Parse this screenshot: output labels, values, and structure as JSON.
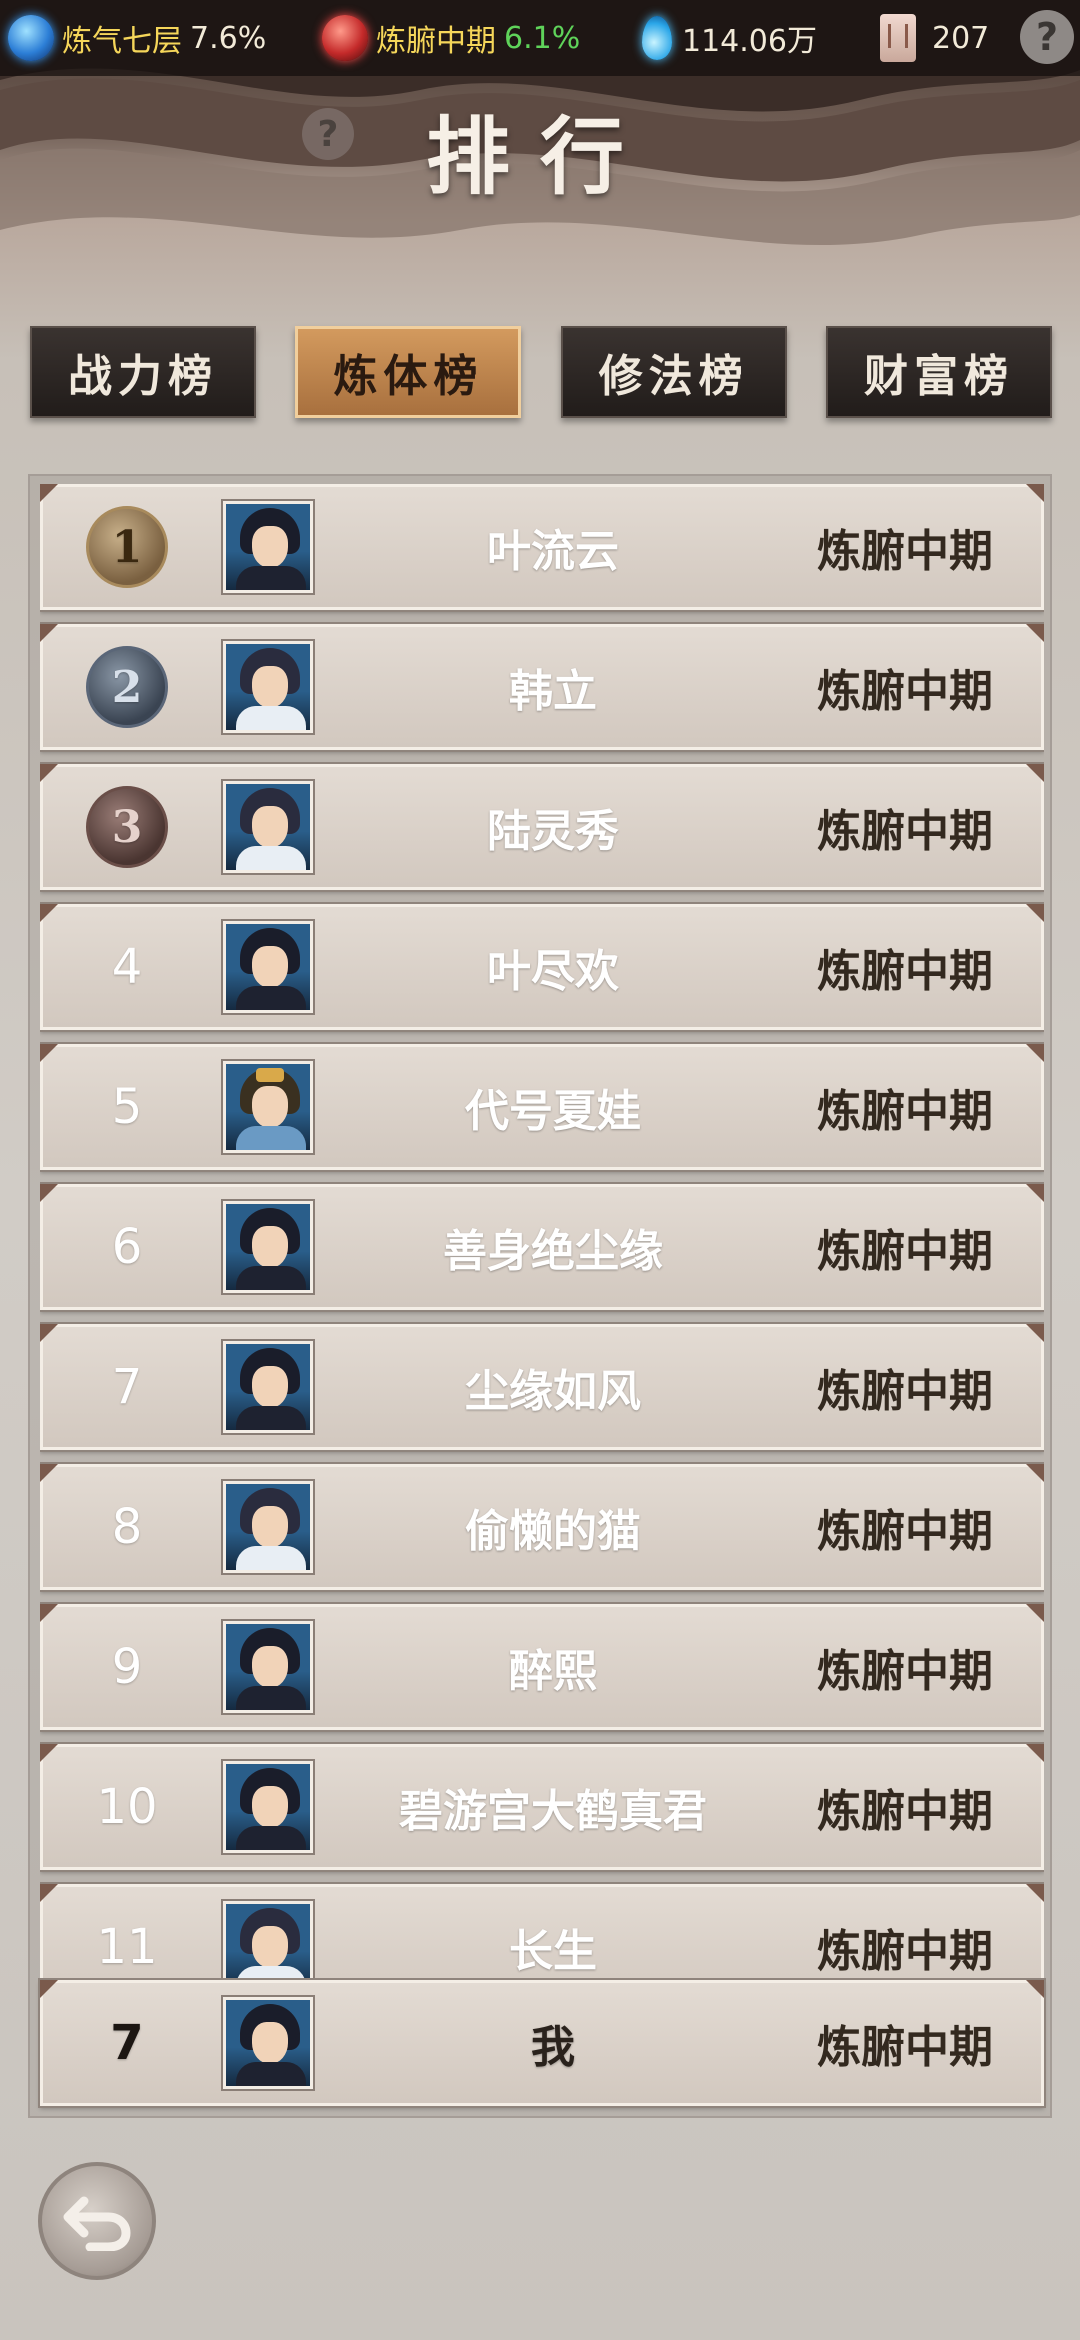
{
  "status": {
    "cultivation_label": "炼气七层",
    "cultivation_pct": "7.6%",
    "body_label": "炼腑中期",
    "body_pct": "6.1%",
    "spirit_stones": "114.06万",
    "scroll_count": "207",
    "help": "?"
  },
  "page": {
    "title": "排行",
    "help": "?"
  },
  "tabs": [
    {
      "label": "战力榜",
      "active": false
    },
    {
      "label": "炼体榜",
      "active": true
    },
    {
      "label": "修法榜",
      "active": false
    },
    {
      "label": "财富榜",
      "active": false
    }
  ],
  "rows": [
    {
      "rank": "1",
      "name": "叶流云",
      "realm": "炼腑中期"
    },
    {
      "rank": "2",
      "name": "韩立",
      "realm": "炼腑中期"
    },
    {
      "rank": "3",
      "name": "陆灵秀",
      "realm": "炼腑中期"
    },
    {
      "rank": "4",
      "name": "叶尽欢",
      "realm": "炼腑中期"
    },
    {
      "rank": "5",
      "name": "代号夏娃",
      "realm": "炼腑中期"
    },
    {
      "rank": "6",
      "name": "善身绝尘缘",
      "realm": "炼腑中期"
    },
    {
      "rank": "7",
      "name": "尘缘如风",
      "realm": "炼腑中期"
    },
    {
      "rank": "8",
      "name": "偷懒的猫",
      "realm": "炼腑中期"
    },
    {
      "rank": "9",
      "name": "醉熙",
      "realm": "炼腑中期"
    },
    {
      "rank": "10",
      "name": "碧游宫大鹤真君",
      "realm": "炼腑中期"
    },
    {
      "rank": "11",
      "name": "长生",
      "realm": "炼腑中期"
    }
  ],
  "me": {
    "rank": "7",
    "name": "我",
    "realm": "炼腑中期"
  },
  "colors": {
    "active_tab": "#c48a52",
    "gold_text": "#f5d65a",
    "green_text": "#5fd35a"
  }
}
